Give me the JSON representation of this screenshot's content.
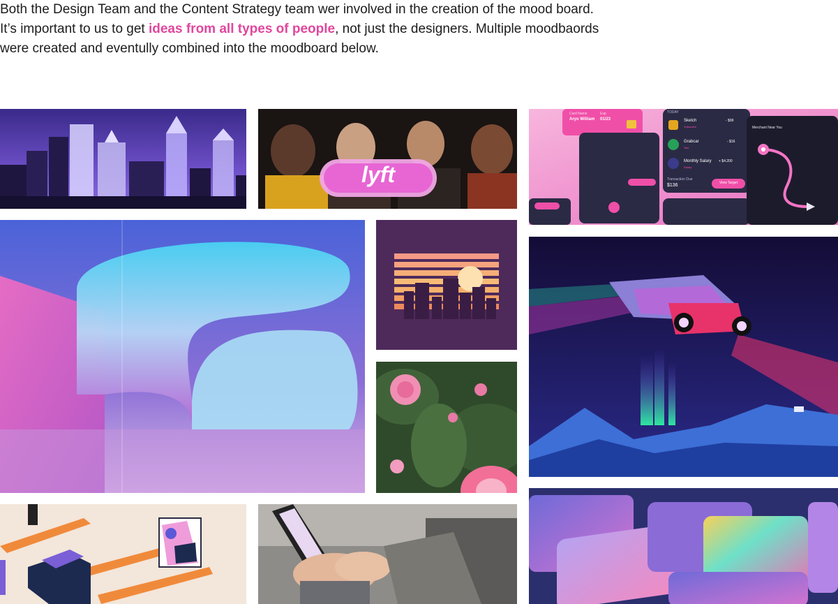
{
  "intro": {
    "before": "Both the Design Team and the Content Strategy team wer involved in the creation of the mood board. It’s important to us to get ",
    "highlight": "ideas from all types of people",
    "after": ", not just the designers. Multiple moodbaords were created and eventully combined into the moodboard below."
  },
  "colors": {
    "accent": "#e0479e",
    "text": "#1d1d1f"
  },
  "moodboard": {
    "lyft_sign": "lyft",
    "app_ui": {
      "card_name": "Aryo William",
      "card_label": "Card Name",
      "exp_label": "Exp",
      "exp": "01/23",
      "today": "TODAY",
      "rows": [
        {
          "name": "Sketch",
          "sub": "Subscribe",
          "amount": "- $99"
        },
        {
          "name": "Grabcar",
          "sub": "Taxi",
          "amount": "- $16"
        },
        {
          "name": "Monthly Salary",
          "sub": "Salary",
          "amount": "+ $4.200"
        }
      ],
      "transaction_label": "Transaction Due",
      "transaction_value": "$136",
      "view_button": "View Target",
      "map_title": "Merchant Near You"
    }
  }
}
